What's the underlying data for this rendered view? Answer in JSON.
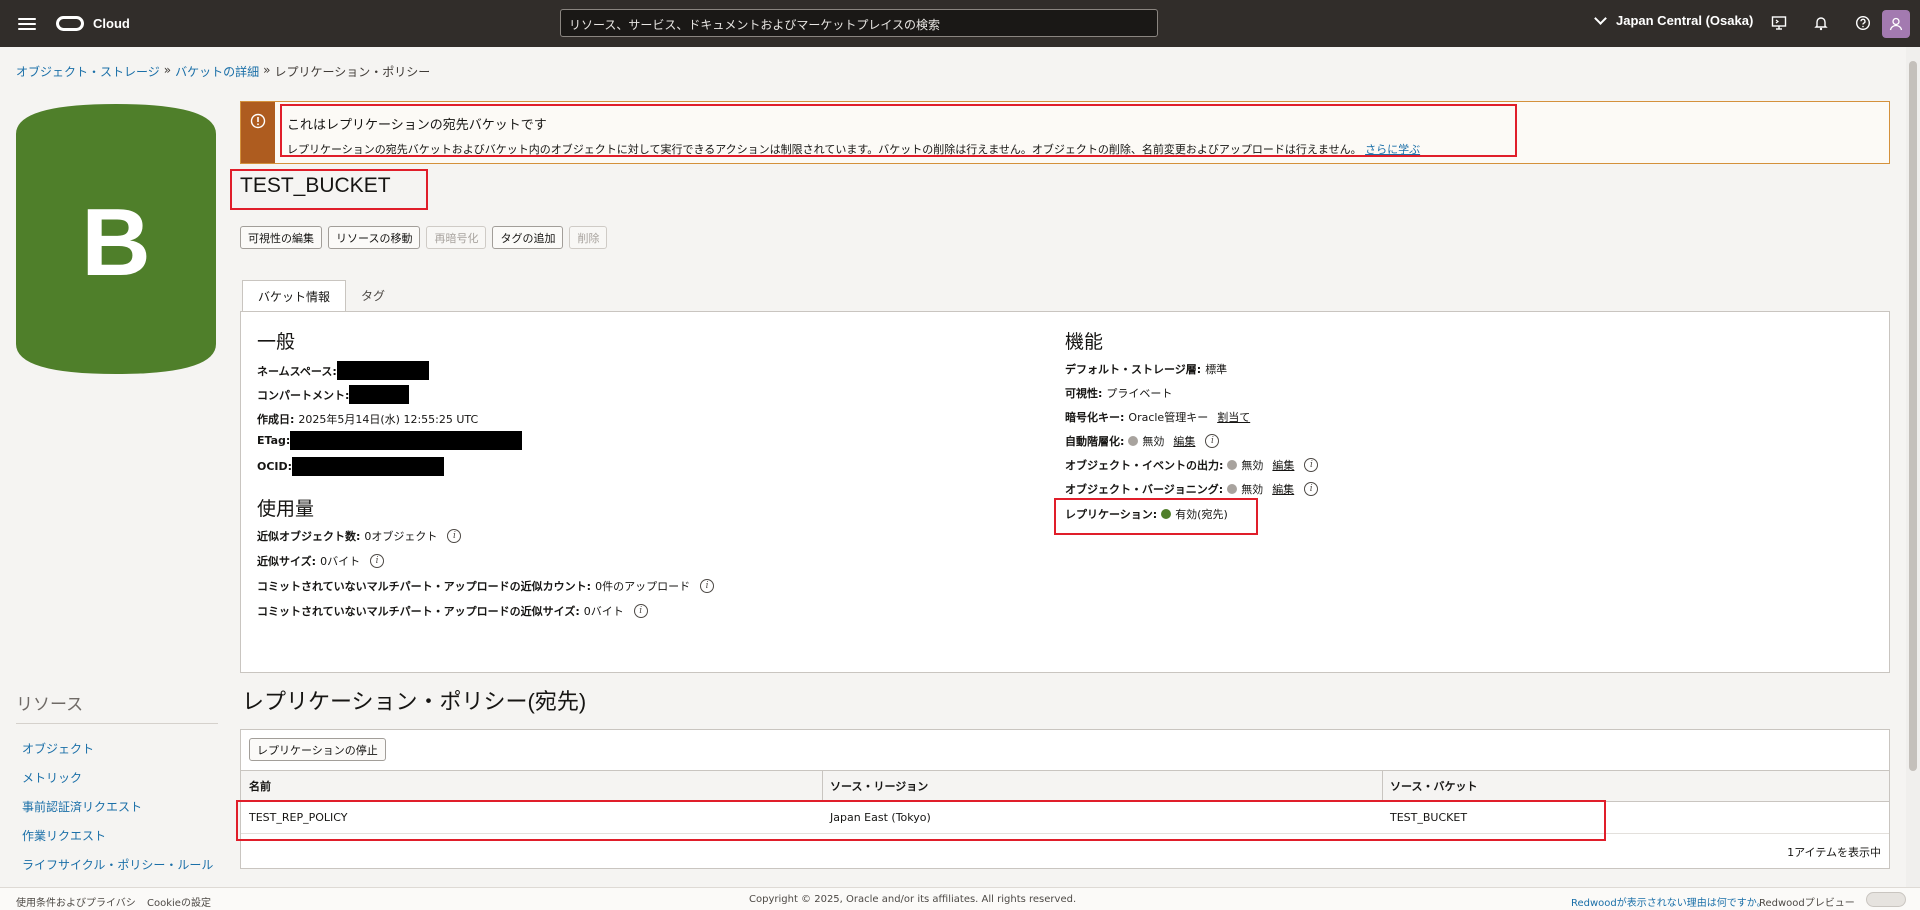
{
  "app": {
    "brand": "Cloud"
  },
  "search": {
    "placeholder": "リソース、サービス、ドキュメントおよびマーケットプレイスの検索"
  },
  "region": {
    "label": "Japan Central (Osaka)"
  },
  "breadcrumb": {
    "items": [
      "オブジェクト・ストレージ",
      "バケットの詳細",
      "レプリケーション・ポリシー"
    ],
    "separator": "»"
  },
  "badge": {
    "letter": "B",
    "color": "#4f7f2a"
  },
  "alert": {
    "title": "これはレプリケーションの宛先バケットです",
    "text": "レプリケーションの宛先バケットおよびバケット内のオブジェクトに対して実行できるアクションは制限されています。バケットの削除は行えません。オブジェクトの削除、名前変更およびアップロードは行えません。",
    "link": "さらに学ぶ",
    "icon": "warning-icon"
  },
  "bucket": {
    "name": "TEST_BUCKET"
  },
  "actions": {
    "edit_visibility": "可視性の編集",
    "move_resource": "リソースの移動",
    "reencrypt": "再暗号化",
    "add_tags": "タグの追加",
    "delete": "削除"
  },
  "tabs": {
    "bucket_info": "バケット情報",
    "tags": "タグ"
  },
  "general": {
    "title": "一般",
    "namespace_label": "ネームスペース:",
    "compartment_label": "コンパートメント:",
    "created_label": "作成日:",
    "created_value": "2025年5月14日(水) 12:55:25 UTC",
    "etag_label": "ETag:",
    "ocid_label": "OCID:"
  },
  "usage": {
    "title": "使用量",
    "objects_label": "近似オブジェクト数:",
    "objects_value": "0オブジェクト",
    "size_label": "近似サイズ:",
    "size_value": "0バイト",
    "multipart_count_label": "コミットされていないマルチパート・アップロードの近似カウント:",
    "multipart_count_value": "0件のアップロード",
    "multipart_size_label": "コミットされていないマルチパート・アップロードの近似サイズ:",
    "multipart_size_value": "0バイト"
  },
  "features": {
    "title": "機能",
    "storage_tier_label": "デフォルト・ストレージ層:",
    "storage_tier_value": "標準",
    "visibility_label": "可視性:",
    "visibility_value": "プライベート",
    "encryption_label": "暗号化キー:",
    "encryption_value": "Oracle管理キー",
    "encryption_link": "割当て",
    "auto_tiering_label": "自動階層化:",
    "auto_tiering_value": "無効",
    "events_label": "オブジェクト・イベントの出力:",
    "events_value": "無効",
    "versioning_label": "オブジェクト・バージョニング:",
    "versioning_value": "無効",
    "replication_label": "レプリケーション:",
    "replication_value": "有効(宛先)",
    "edit_label": "編集",
    "disabled_color": "#a8a39e",
    "enabled_color": "#4f7f2a"
  },
  "policy": {
    "title": "レプリケーション・ポリシー(宛先)",
    "stop_button": "レプリケーションの停止",
    "columns": [
      "名前",
      "ソース・リージョン",
      "ソース・バケット"
    ],
    "rows": [
      [
        "TEST_REP_POLICY",
        "Japan East (Tokyo)",
        "TEST_BUCKET"
      ]
    ],
    "count": "1アイテムを表示中"
  },
  "resources": {
    "title": "リソース",
    "items": [
      "オブジェクト",
      "メトリック",
      "事前認証済リクエスト",
      "作業リクエスト",
      "ライフサイクル・ポリシー・ルール"
    ]
  },
  "footer": {
    "terms": "使用条件およびプライバシ",
    "cookies": "Cookieの設定",
    "copyright": "Copyright © 2025, Oracle and/or its affiliates. All rights reserved.",
    "redwood_reason": "Redwoodが表示されない理由は何ですか。",
    "redwood_preview": "Redwoodプレビュー"
  },
  "colors": {
    "highlight": "#e01e2a",
    "link": "#1a6fa8",
    "topbar": "#312d2a"
  }
}
